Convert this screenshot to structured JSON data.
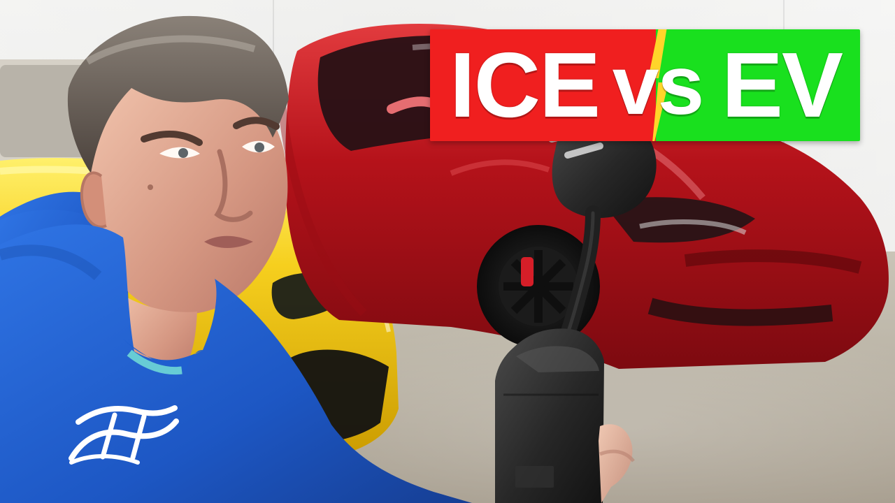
{
  "thumbnail": {
    "title": {
      "part_1": "ICE",
      "part_2": "vs",
      "part_3": "EV"
    },
    "colors": {
      "banner_left": "#f01f1f",
      "banner_right": "#19e01e",
      "bolt": "#ffd52a",
      "text": "#ffffff",
      "yellow_car": "#f6cf1e",
      "red_car": "#b5121a",
      "hoodie": "#1d57c4"
    }
  }
}
